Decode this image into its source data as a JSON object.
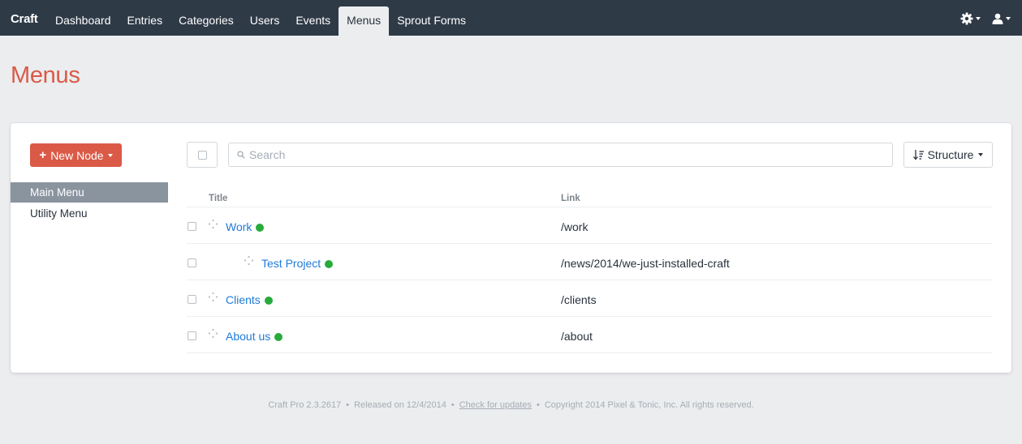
{
  "header": {
    "brand": "Craft",
    "tabs": [
      {
        "label": "Dashboard",
        "selected": false
      },
      {
        "label": "Entries",
        "selected": false
      },
      {
        "label": "Categories",
        "selected": false
      },
      {
        "label": "Users",
        "selected": false
      },
      {
        "label": "Events",
        "selected": false
      },
      {
        "label": "Menus",
        "selected": true
      },
      {
        "label": "Sprout Forms",
        "selected": false
      }
    ],
    "icons": [
      "gear-icon",
      "user-icon"
    ]
  },
  "page": {
    "title": "Menus"
  },
  "sidebar": {
    "new_button": "New Node",
    "items": [
      {
        "label": "Main Menu",
        "selected": true
      },
      {
        "label": "Utility Menu",
        "selected": false
      }
    ]
  },
  "toolbar": {
    "search_placeholder": "Search",
    "search_value": "",
    "structure_label": "Structure"
  },
  "table": {
    "columns": [
      "Title",
      "Link"
    ],
    "rows": [
      {
        "title": "Work",
        "link": "/work",
        "level": 1,
        "status": "enabled"
      },
      {
        "title": "Test Project",
        "link": "/news/2014/we-just-installed-craft",
        "level": 2,
        "status": "enabled"
      },
      {
        "title": "Clients",
        "link": "/clients",
        "level": 1,
        "status": "enabled"
      },
      {
        "title": "About us",
        "link": "/about",
        "level": 1,
        "status": "enabled"
      }
    ]
  },
  "footer": {
    "version": "Craft Pro 2.3.2617",
    "released": "Released on 12/4/2014",
    "check_updates": "Check for updates",
    "copyright": "Copyright 2014 Pixel & Tonic, Inc. All rights reserved.",
    "separator": "•"
  },
  "colors": {
    "header_bg": "#2f3a47",
    "accent_red": "#da5a47",
    "link_blue": "#1f7ad8",
    "status_green": "#27ab3b",
    "selected_sidebar": "#8a949f"
  }
}
